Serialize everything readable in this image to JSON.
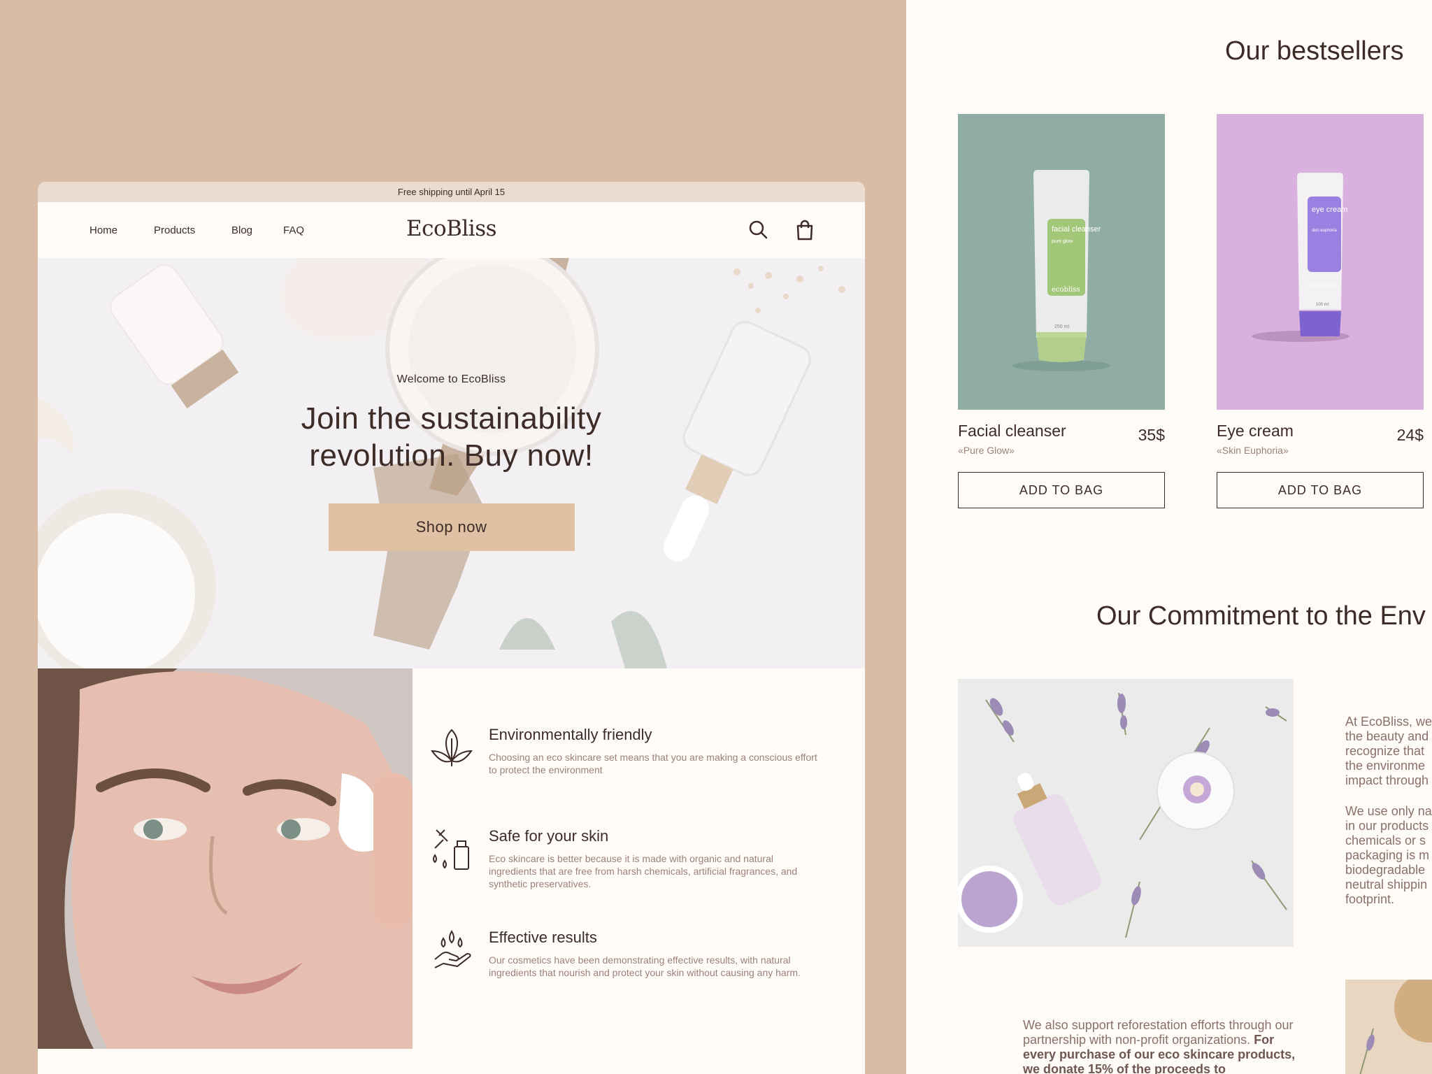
{
  "promo_bar": {
    "text": "Free shipping until April 15"
  },
  "nav": {
    "links": [
      "Home",
      "Products",
      "Blog",
      "FAQ"
    ],
    "logo": "EcoBliss",
    "icons": [
      "search-icon",
      "shopping-bag-icon"
    ]
  },
  "hero": {
    "welcome": "Welcome to EcoBliss",
    "title": "Join the sustainability revolution. Buy now!",
    "button": "Shop now"
  },
  "features": [
    {
      "icon": "leaf-icon",
      "title": "Environmentally friendly",
      "description": "Choosing an eco skincare set means that you are making a conscious effort to protect the environment"
    },
    {
      "icon": "dropper-bottle-icon",
      "title": "Safe for your skin",
      "description": "Eco skincare is better because it is made with organic and natural ingredients that are free from harsh chemicals, artificial fragrances, and synthetic preservatives."
    },
    {
      "icon": "hand-drops-icon",
      "title": "Effective results",
      "description": "Our cosmetics have been demonstrating effective results, with natural ingredients that nourish and protect your skin without causing any harm."
    }
  ],
  "bestsellers": {
    "title": "Our bestsellers",
    "products": [
      {
        "name": "Facial cleanser",
        "subtitle": "«Pure Glow»",
        "price": "35$",
        "button": "ADD TO BAG",
        "tube_label": "facial cleanser",
        "tube_sub": "pure glow",
        "brand": "ecobliss",
        "volume": "250 ml",
        "bg_color": "#8faca5",
        "accent_color": "#a3c779"
      },
      {
        "name": "Eye cream",
        "subtitle": "«Skin Euphoria»",
        "price": "24$",
        "button": "ADD TO BAG",
        "tube_label": "eye cream",
        "tube_sub": "skin euphoria",
        "brand": "ecobliss",
        "volume": "100 ml",
        "bg_color": "#d9b1de",
        "accent_color": "#9a80e0"
      }
    ]
  },
  "commitment": {
    "title": "Our Commitment to the Env",
    "paragraph1": "At EcoBliss, we\nthe beauty and\nrecognize that\nthe environme\nimpact through",
    "paragraph2": "We use only na\nin our products\nchemicals or s\npackaging is m\nbiodegradable\nneutral shippin\nfootprint.",
    "paragraph3_normal": "We also support reforestation efforts through our partnership with non-profit organizations. ",
    "paragraph3_bold": "For every purchase of our eco skincare products, we donate 15% of the proceeds to"
  },
  "colors": {
    "page_bg": "#d9bca6",
    "panel_bg": "#fffcf8",
    "text": "#3d2b28",
    "muted_text": "#9b817a",
    "accent_button": "#e0c1a3",
    "promo_bg": "#ebdcd0"
  }
}
